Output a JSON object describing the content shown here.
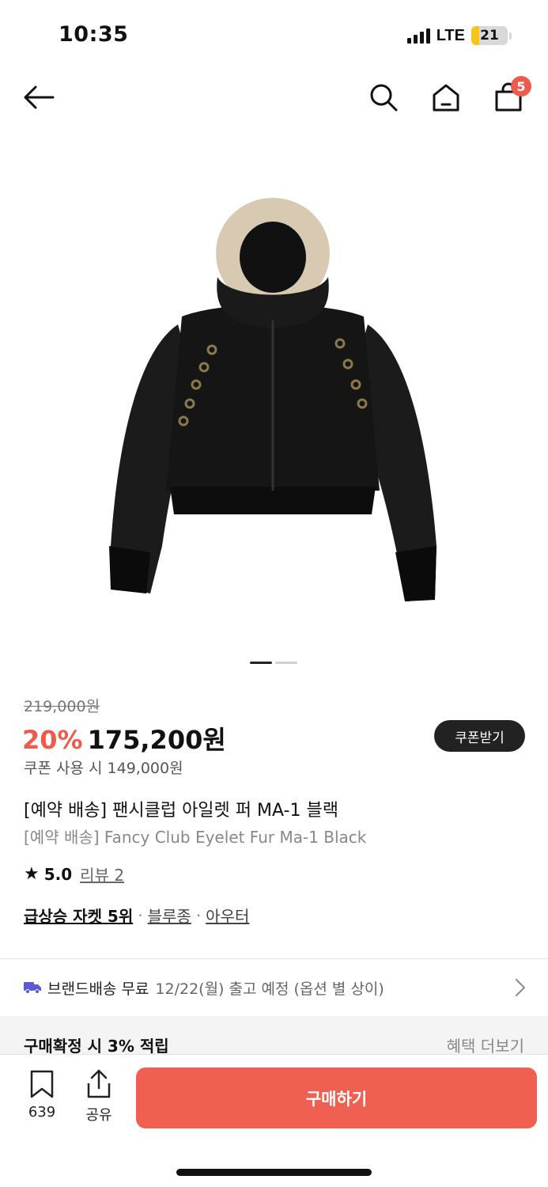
{
  "status_bar": {
    "time": "10:35",
    "network": "LTE",
    "battery_level": "21",
    "battery_fraction": 0.21
  },
  "nav": {
    "cart_count": "5",
    "icons": [
      "back-arrow-icon",
      "search-icon",
      "home-icon",
      "cart-icon"
    ]
  },
  "product": {
    "image_alt": "black jacket with fur hood",
    "carousel_index": 1,
    "carousel_total": 2,
    "original_price": "219,000원",
    "discount": "20%",
    "sale_price": "175,200원",
    "coupon_button": "쿠폰받기",
    "coupon_price": "쿠폰 사용 시 149,000원",
    "title_ko": "[예약 배송] 팬시클럽 아일렛 퍼 MA-1 블랙",
    "title_en": "[예약 배송] Fancy Club Eyelet Fur Ma-1 Black",
    "rating": "5.0",
    "review_link": "리뷰 2",
    "tags": {
      "rank": "급상승 자켓 5위",
      "sep": "·",
      "tag1": "블루종",
      "tag2": "아우터"
    }
  },
  "delivery": {
    "main": "브랜드배송 무료",
    "sub": "12/22(월) 출고 예정 (옵션 별 상이)"
  },
  "benefits": {
    "points": "구매확정 시 3% 적립",
    "more_link": "혜택 더보기"
  },
  "bottom_bar": {
    "bookmark_count": "639",
    "share_label": "공유",
    "buy_label": "구매하기"
  },
  "colors": {
    "accent": "#ee5b4c",
    "buy_button": "#ef5f52",
    "dark": "#222222",
    "delivery_icon": "#5b5bd6"
  }
}
